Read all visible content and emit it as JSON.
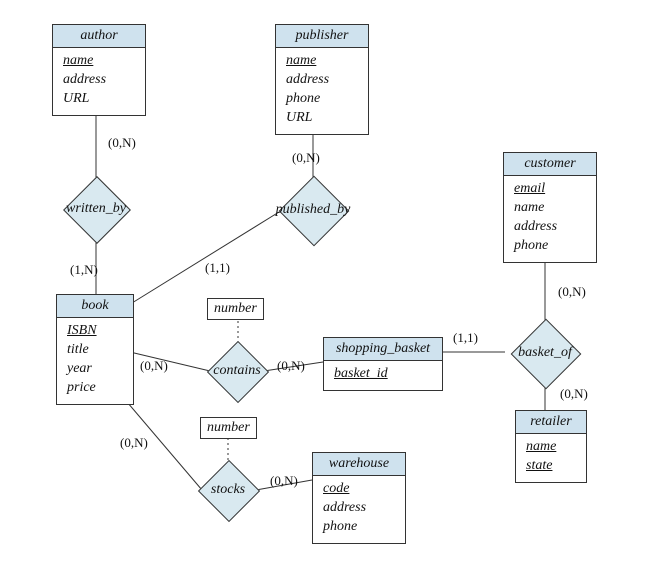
{
  "entities": {
    "author": {
      "title": "author",
      "attrs": [
        "name",
        "address",
        "URL"
      ],
      "keys": [
        "name"
      ]
    },
    "publisher": {
      "title": "publisher",
      "attrs": [
        "name",
        "address",
        "phone",
        "URL"
      ],
      "keys": [
        "name"
      ]
    },
    "customer": {
      "title": "customer",
      "attrs": [
        "email",
        "name",
        "address",
        "phone"
      ],
      "keys": [
        "email"
      ]
    },
    "book": {
      "title": "book",
      "attrs": [
        "ISBN",
        "title",
        "year",
        "price"
      ],
      "keys": [
        "ISBN"
      ]
    },
    "shopping_basket": {
      "title": "shopping_basket",
      "attrs": [
        "basket_id"
      ],
      "keys": [
        "basket_id"
      ]
    },
    "warehouse": {
      "title": "warehouse",
      "attrs": [
        "code",
        "address",
        "phone"
      ],
      "keys": [
        "code"
      ]
    },
    "retailer": {
      "title": "retailer",
      "attrs": [
        "name",
        "state"
      ],
      "keys": [
        "name",
        "state"
      ]
    }
  },
  "relationships": {
    "written_by": {
      "label": "written_by",
      "attr": null
    },
    "published_by": {
      "label": "published_by",
      "attr": null
    },
    "contains": {
      "label": "contains",
      "attr": "number"
    },
    "stocks": {
      "label": "stocks",
      "attr": "number"
    },
    "basket_of": {
      "label": "basket_of",
      "attr": null
    }
  },
  "cardinalities": {
    "author_written_by": "(0,N)",
    "book_written_by": "(1,N)",
    "publisher_published_by": "(0,N)",
    "book_published_by": "(1,1)",
    "book_contains": "(0,N)",
    "basket_contains": "(0,N)",
    "book_stocks": "(0,N)",
    "warehouse_stocks": "(0,N)",
    "basket_basket_of": "(1,1)",
    "customer_basket_of": "(0,N)",
    "retailer_basket_of": "(0,N)"
  },
  "chart_data": {
    "type": "er-diagram",
    "entities": [
      {
        "name": "author",
        "attributes": [
          "name",
          "address",
          "URL"
        ],
        "primary_key": [
          "name"
        ]
      },
      {
        "name": "publisher",
        "attributes": [
          "name",
          "address",
          "phone",
          "URL"
        ],
        "primary_key": [
          "name"
        ]
      },
      {
        "name": "customer",
        "attributes": [
          "email",
          "name",
          "address",
          "phone"
        ],
        "primary_key": [
          "email"
        ]
      },
      {
        "name": "book",
        "attributes": [
          "ISBN",
          "title",
          "year",
          "price"
        ],
        "primary_key": [
          "ISBN"
        ]
      },
      {
        "name": "shopping_basket",
        "attributes": [
          "basket_id"
        ],
        "primary_key": [
          "basket_id"
        ]
      },
      {
        "name": "warehouse",
        "attributes": [
          "code",
          "address",
          "phone"
        ],
        "primary_key": [
          "code"
        ]
      },
      {
        "name": "retailer",
        "attributes": [
          "name",
          "state"
        ],
        "primary_key": [
          "name",
          "state"
        ]
      }
    ],
    "relationships": [
      {
        "name": "written_by",
        "between": [
          "author",
          "book"
        ],
        "cardinality": {
          "author": "(0,N)",
          "book": "(1,N)"
        }
      },
      {
        "name": "published_by",
        "between": [
          "publisher",
          "book"
        ],
        "cardinality": {
          "publisher": "(0,N)",
          "book": "(1,1)"
        }
      },
      {
        "name": "contains",
        "between": [
          "book",
          "shopping_basket"
        ],
        "attributes": [
          "number"
        ],
        "cardinality": {
          "book": "(0,N)",
          "shopping_basket": "(0,N)"
        }
      },
      {
        "name": "stocks",
        "between": [
          "book",
          "warehouse"
        ],
        "attributes": [
          "number"
        ],
        "cardinality": {
          "book": "(0,N)",
          "warehouse": "(0,N)"
        }
      },
      {
        "name": "basket_of",
        "between": [
          "shopping_basket",
          "customer",
          "retailer"
        ],
        "cardinality": {
          "shopping_basket": "(1,1)",
          "customer": "(0,N)",
          "retailer": "(0,N)"
        }
      }
    ]
  }
}
